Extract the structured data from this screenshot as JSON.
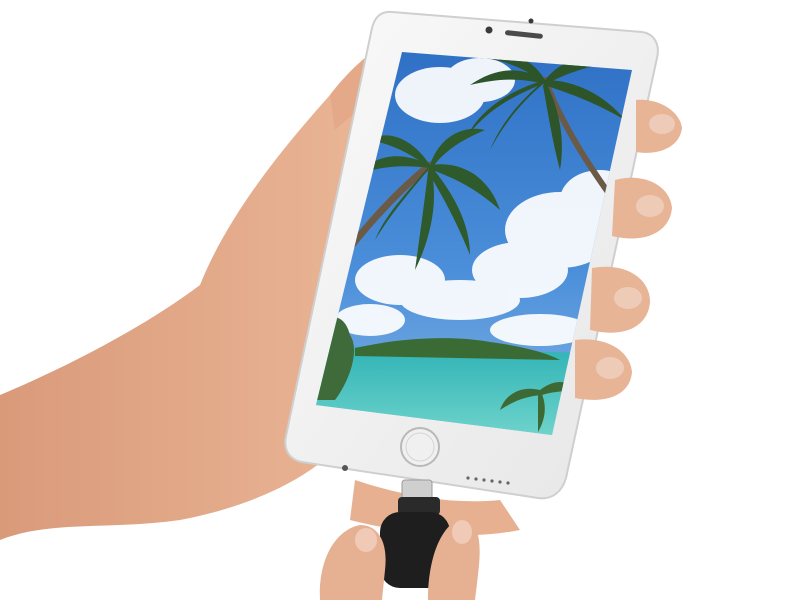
{
  "scene": {
    "background_color": "#ffffff",
    "skin_color": "#e8b496",
    "phone_body_color": "#f4f4f4",
    "phone_edge_color": "#d8d8d8",
    "connector_color": "#1e1e1e",
    "sky_color": "#3b7fd0",
    "sea_color": "#47c9c0",
    "island_color": "#3b6b35",
    "palm_frond_color": "#2f5a2c"
  }
}
